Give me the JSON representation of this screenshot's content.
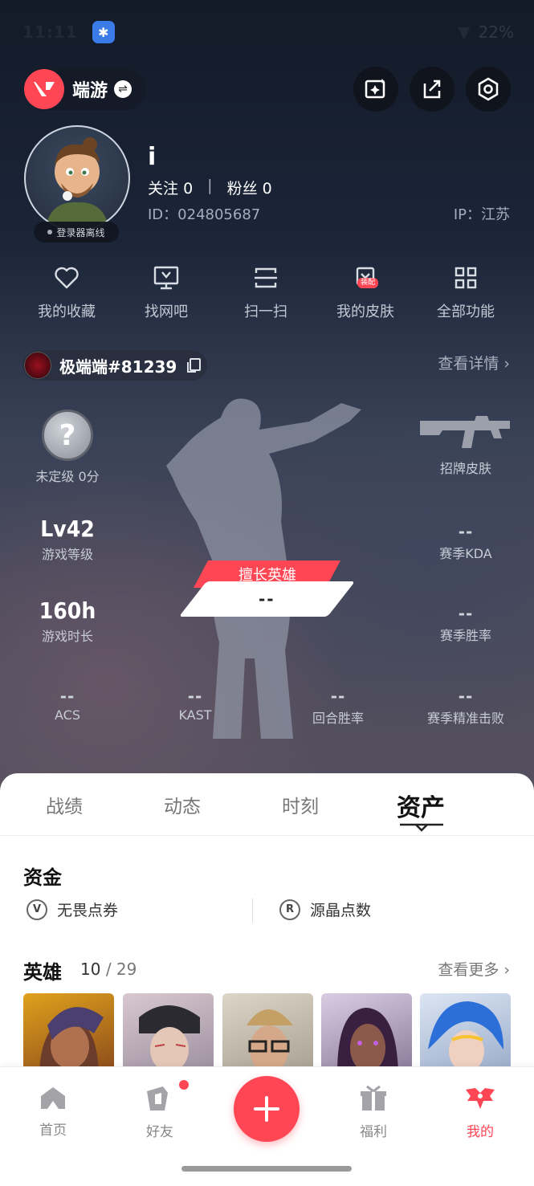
{
  "status_bar": {
    "time": "11:11",
    "battery": "22%"
  },
  "game": {
    "name": "端游"
  },
  "profile": {
    "username": "i",
    "following_label": "关注",
    "following_count": "0",
    "fans_label": "粉丝",
    "fans_count": "0",
    "id_text": "ID：024805687",
    "ip_text": "IP：江苏",
    "status": "登录器离线"
  },
  "shortcuts": [
    {
      "label": "我的收藏",
      "icon": "heart-icon"
    },
    {
      "label": "找网吧",
      "icon": "monitor-icon"
    },
    {
      "label": "扫一扫",
      "icon": "scan-icon"
    },
    {
      "label": "我的皮肤",
      "icon": "skin-icon",
      "badge": "装配"
    },
    {
      "label": "全部功能",
      "icon": "grid-icon"
    }
  ],
  "riot": {
    "name": "极端端#81239",
    "detail_link": "查看详情"
  },
  "stats": {
    "rank_label": "未定级 0分",
    "featured_skin_label": "招牌皮肤",
    "level_value": "Lv42",
    "level_label": "游戏等级",
    "kda_value": "--",
    "kda_label": "赛季KDA",
    "playtime_value": "160h",
    "playtime_label": "游戏时长",
    "winrate_value": "--",
    "winrate_label": "赛季胜率",
    "best_hero_tag": "擅长英雄",
    "best_hero_value": "--",
    "acs_value": "--",
    "acs_label": "ACS",
    "kast_value": "--",
    "kast_label": "KAST",
    "round_win_value": "--",
    "round_win_label": "回合胜率",
    "precise_kill_value": "--",
    "precise_kill_label": "赛季精准击败"
  },
  "tabs": [
    "战绩",
    "动态",
    "时刻",
    "资产"
  ],
  "assets": {
    "funds_title": "资金",
    "vp_label": "无畏点券",
    "rp_label": "源晶点数",
    "heroes_title": "英雄",
    "heroes_owned": "10",
    "heroes_total": "29",
    "heroes_sep": "/",
    "more_link": "查看更多"
  },
  "bottom_nav": [
    {
      "label": "首页",
      "icon": "home-icon"
    },
    {
      "label": "好友",
      "icon": "friends-icon"
    },
    {
      "label": "福利",
      "icon": "gift-icon"
    },
    {
      "label": "我的",
      "icon": "me-icon"
    }
  ],
  "colors": {
    "accent": "#ff4655",
    "background": "#1a2234"
  }
}
